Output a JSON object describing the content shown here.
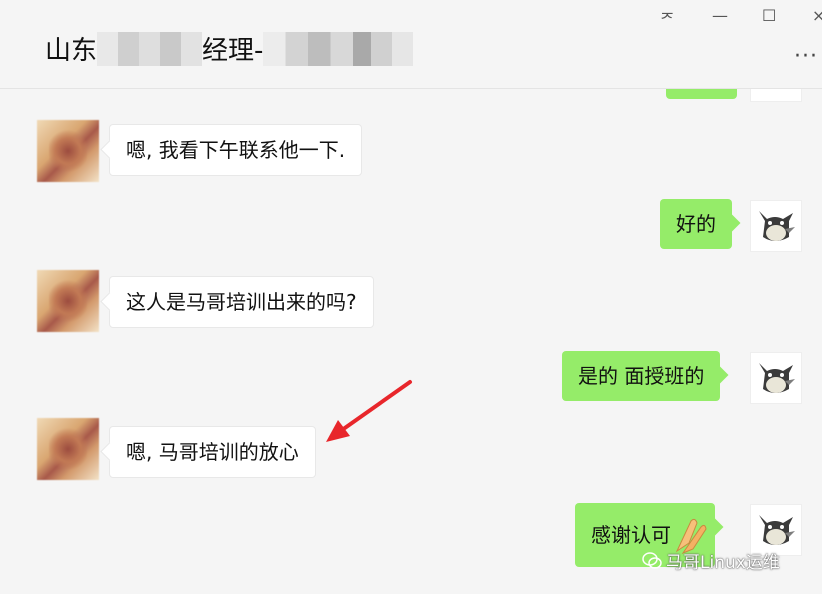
{
  "window": {
    "title_prefix": "山东",
    "title_suffix": "经理-",
    "pin_label": "ᅎ",
    "minimize_label": "—",
    "maximize_label": "☐",
    "close_label": "×",
    "more_label": "···"
  },
  "messages": [
    {
      "side": "left",
      "text": "嗯, 我看下午联系他一下."
    },
    {
      "side": "right",
      "text": "好的"
    },
    {
      "side": "left",
      "text": "这人是马哥培训出来的吗?"
    },
    {
      "side": "right",
      "text": "是的  面授班的"
    },
    {
      "side": "left",
      "text": "嗯, 马哥培训的放心"
    },
    {
      "side": "right",
      "text": "感谢认可"
    }
  ],
  "annotation": {
    "color": "#e8262b"
  },
  "watermark": {
    "text": "马哥Linux运维"
  },
  "colors": {
    "bubble_green": "#95ec69",
    "background": "#f5f5f5"
  }
}
